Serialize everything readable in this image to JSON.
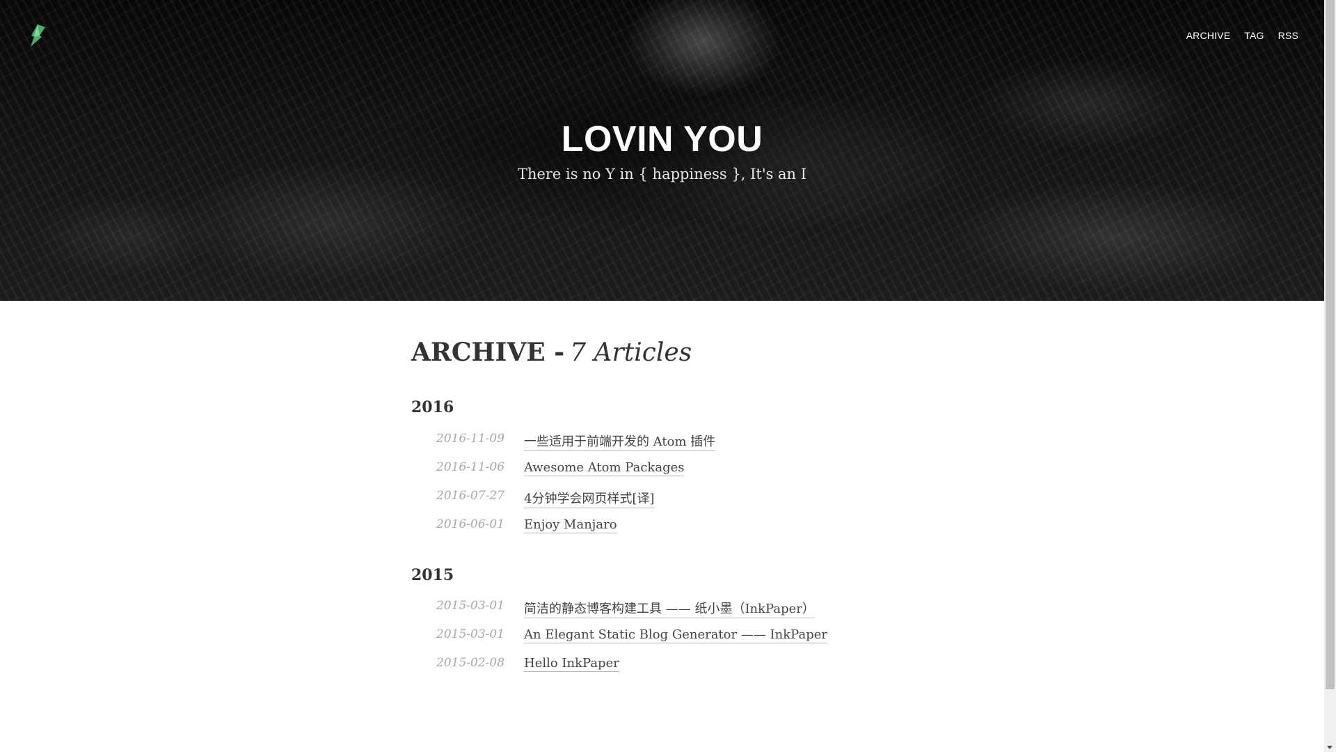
{
  "header": {
    "logo_icon": "leaf-logo-icon",
    "logo_color": "#4caf6e",
    "nav": [
      {
        "label": "ARCHIVE"
      },
      {
        "label": "TAG"
      },
      {
        "label": "RSS"
      }
    ],
    "title": "LOVIN YOU",
    "subtitle": "There is no Y in { happiness }, It's an I"
  },
  "archive": {
    "heading": "ARCHIVE -",
    "count_label": "7 Articles",
    "years": [
      {
        "year": "2016",
        "posts": [
          {
            "date": "2016-11-09",
            "title": "一些适用于前端开发的 Atom 插件"
          },
          {
            "date": "2016-11-06",
            "title": "Awesome Atom Packages"
          },
          {
            "date": "2016-07-27",
            "title": "4分钟学会网页样式[译]"
          },
          {
            "date": "2016-06-01",
            "title": "Enjoy Manjaro"
          }
        ]
      },
      {
        "year": "2015",
        "posts": [
          {
            "date": "2015-03-01",
            "title": "简洁的静态博客构建工具 —— 纸小墨（InkPaper）"
          },
          {
            "date": "2015-03-01",
            "title": "An Elegant Static Blog Generator —— InkPaper"
          },
          {
            "date": "2015-02-08",
            "title": "Hello InkPaper"
          }
        ]
      }
    ]
  }
}
